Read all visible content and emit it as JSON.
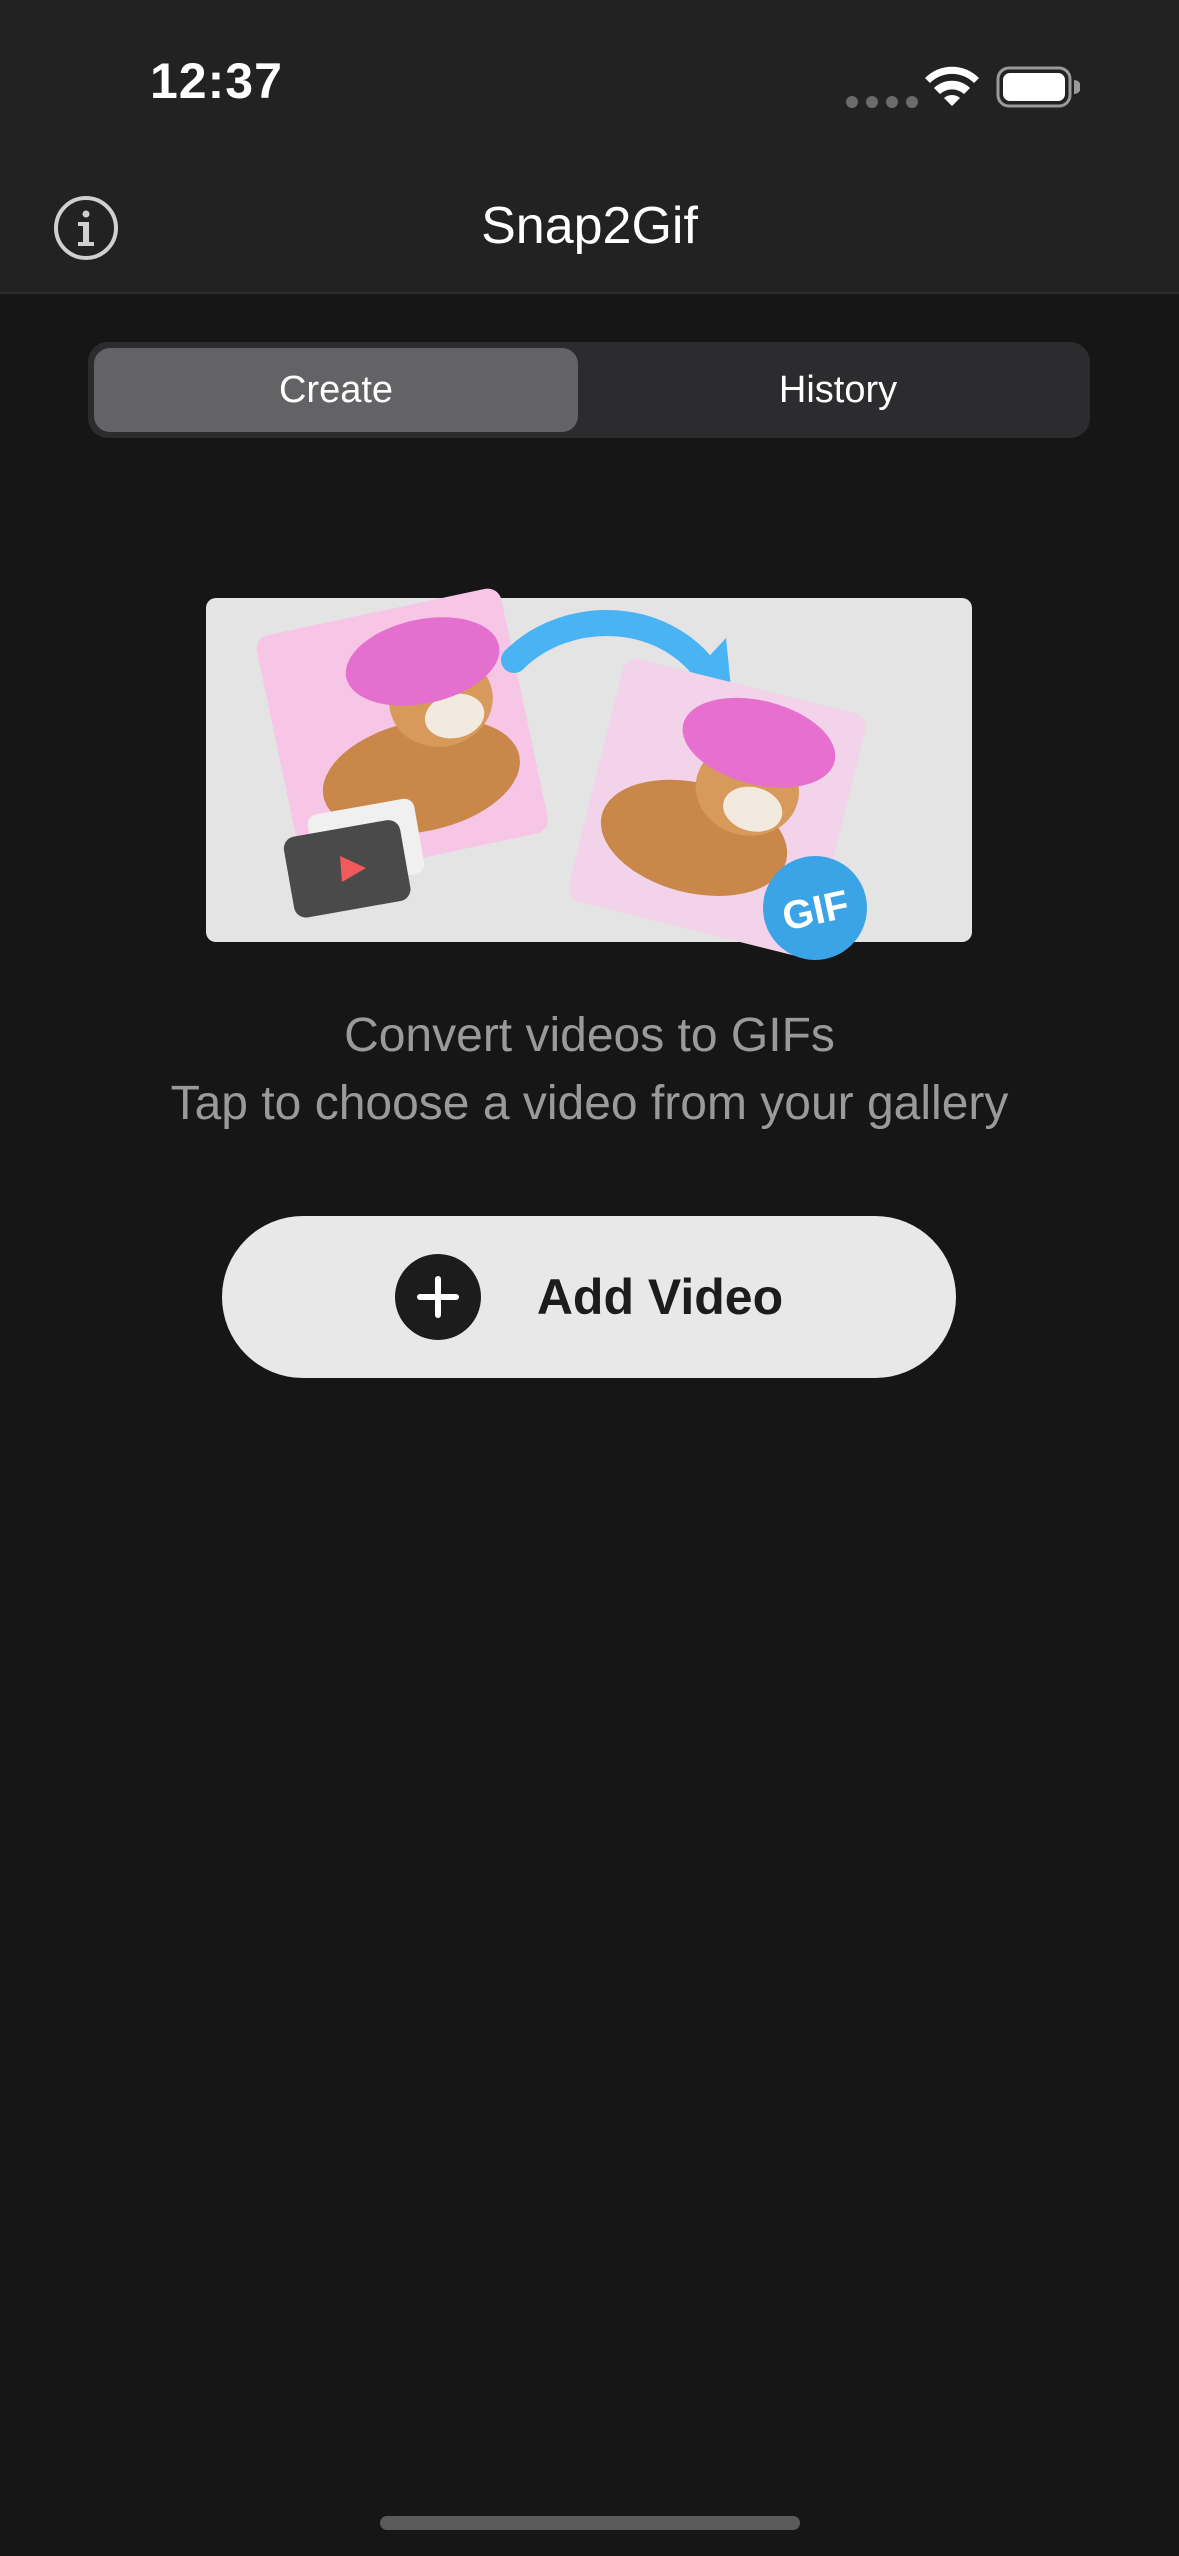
{
  "status_bar": {
    "time": "12:37"
  },
  "nav": {
    "title": "Snap2Gif",
    "info_icon": "info-circle-icon"
  },
  "segmented": {
    "tabs": [
      "Create",
      "History"
    ],
    "selected": "Create"
  },
  "illustration": {
    "badge_text": "GIF",
    "icons": [
      "video-play-icon",
      "arrow-icon",
      "gif-badge-icon"
    ]
  },
  "description": {
    "line1": "Convert videos to GIFs",
    "line2": "Tap to choose a video from your gallery"
  },
  "add_button": {
    "label": "Add Video",
    "icon": "plus-circle-icon"
  },
  "colors": {
    "background": "#161616",
    "topbar": "#222222",
    "segment_selected": "#636366",
    "button_bg": "#e8e8e8",
    "accent_blue": "#4ab3f4",
    "pink": "#f3a9d9"
  }
}
